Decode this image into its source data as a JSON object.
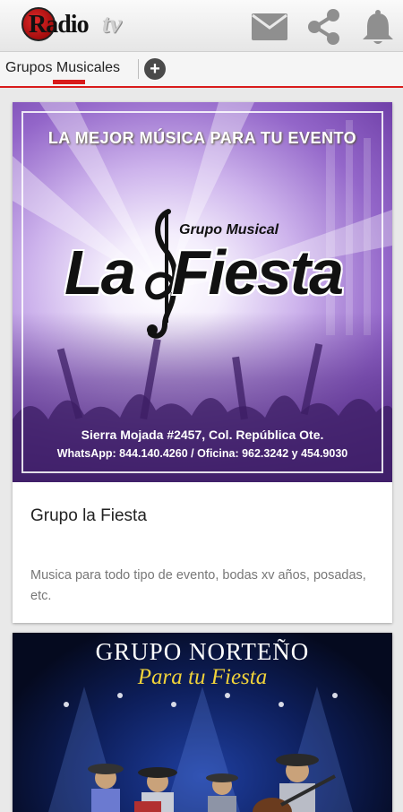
{
  "appbar": {
    "logo_text": "Radio",
    "logo_suffix": "tv",
    "icons": [
      "mail-icon",
      "share-icon",
      "bell-icon"
    ]
  },
  "tabs": {
    "active_label": "Grupos Musicales",
    "add_symbol": "+"
  },
  "cards": [
    {
      "banner": {
        "slogan": "LA MEJOR MÚSICA PARA TU EVENTO",
        "subtitle": "Grupo Musical",
        "name_left": "La",
        "name_right": "Fiesta",
        "address": "Sierra Mojada #2457, Col. República Ote.",
        "phones": "WhatsApp: 844.140.4260 / Oficina: 962.3242 y 454.9030"
      },
      "title": "Grupo la Fiesta",
      "description": "Musica para todo tipo de evento, bodas xv años, posadas, etc."
    },
    {
      "banner": {
        "title": "GRUPO NORTEÑO",
        "subtitle": "Para tu Fiesta"
      }
    }
  ],
  "colors": {
    "accent": "#d91b1b",
    "purple": "#7b4ab5",
    "stage_blue": "#0d1e5a",
    "gold": "#f0d23a"
  }
}
